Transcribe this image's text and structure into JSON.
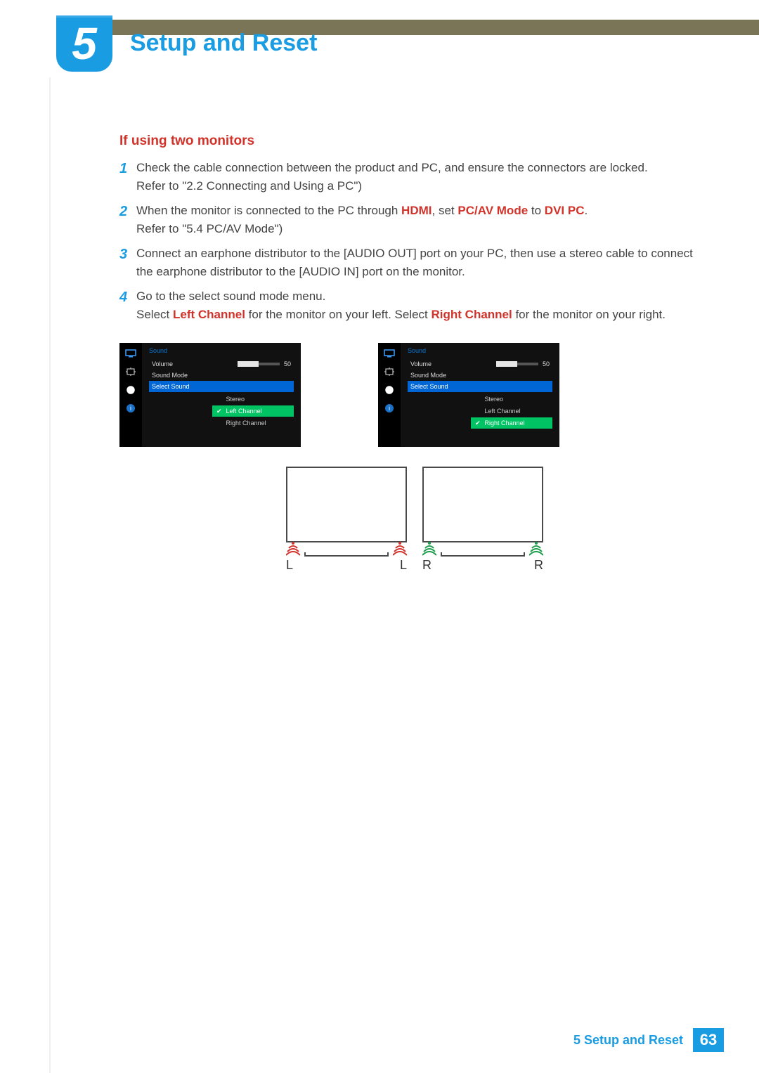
{
  "chapter": {
    "number": "5",
    "title": "Setup and Reset"
  },
  "subheading": "If using two monitors",
  "steps": {
    "s1a": "Check the cable connection between the product and PC, and ensure the connectors are locked.",
    "s1b": "Refer to \"2.2 Connecting and Using a PC\")",
    "s2a_pre": "When the monitor is connected to the PC through ",
    "s2a_hdmi": "HDMI",
    "s2a_mid": ", set ",
    "s2a_pcav": "PC/AV Mode",
    "s2a_to": " to ",
    "s2a_dvi": "DVI PC",
    "s2a_end": ".",
    "s2b": "Refer to \"5.4 PC/AV Mode\")",
    "s3": "Connect an earphone distributor to the [AUDIO OUT] port on your PC, then use a stereo cable to connect the earphone distributor to the [AUDIO IN] port on the monitor.",
    "s4a": "Go to the select sound mode menu.",
    "s4b_pre": "Select ",
    "s4b_lc": "Left Channel",
    "s4b_mid": " for the monitor on your left. Select ",
    "s4b_rc": "Right Channel",
    "s4b_end": " for the monitor on your right."
  },
  "osd": {
    "title": "Sound",
    "volume_label": "Volume",
    "volume_value": "50",
    "soundmode_label": "Sound Mode",
    "selectsound_label": "Select Sound",
    "opts": {
      "stereo": "Stereo",
      "left": "Left Channel",
      "right": "Right Channel"
    }
  },
  "diagram": {
    "L": "L",
    "R": "R"
  },
  "footer": {
    "chapter": "5 Setup and Reset",
    "page": "63"
  }
}
